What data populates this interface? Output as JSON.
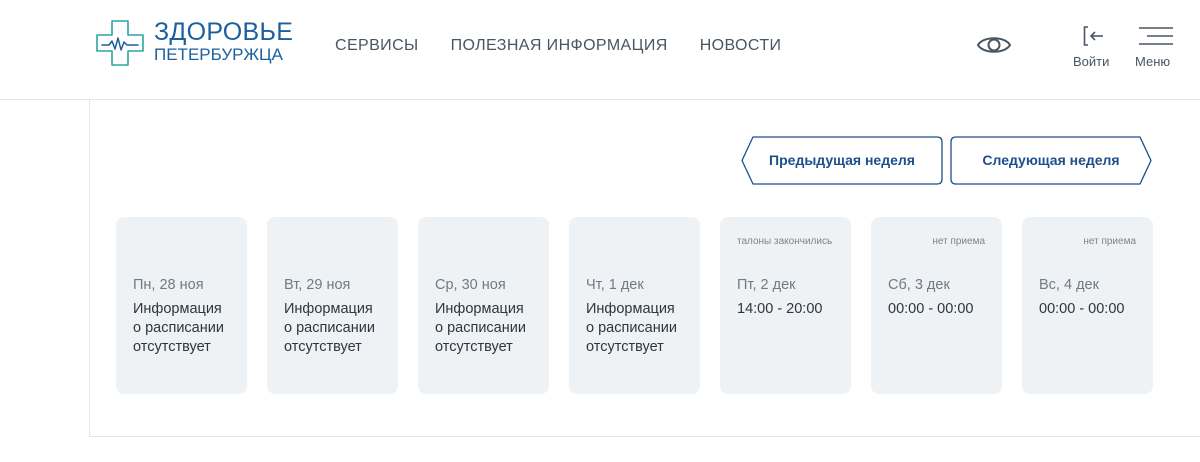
{
  "header": {
    "logo": {
      "title": "ЗДОРОВЬЕ",
      "subtitle": "ПЕТЕРБУРЖЦА",
      "accent": "#1b5f9e",
      "mark_color": "#2aa6a0"
    },
    "nav": [
      {
        "label": "СЕРВИСЫ"
      },
      {
        "label": "ПОЛЕЗНАЯ ИНФОРМАЦИЯ"
      },
      {
        "label": "НОВОСТИ"
      }
    ],
    "accessibility_icon": "eye-icon",
    "login": {
      "label": "Войти",
      "icon": "sign-in-icon"
    },
    "menu": {
      "label": "Меню",
      "icon": "hamburger-icon"
    }
  },
  "schedule": {
    "prev_week_label": "Предыдущая неделя",
    "next_week_label": "Следующая неделя",
    "button_color": "#1d4f8b",
    "card_color": "#eff2f4",
    "days": [
      {
        "note": "",
        "date": "Пн, 28 ноя",
        "info": "Информация о расписании отсутствует"
      },
      {
        "note": "",
        "date": "Вт, 29 ноя",
        "info": "Информация о расписании отсутствует"
      },
      {
        "note": "",
        "date": "Ср, 30 ноя",
        "info": "Информация о расписании отсутствует"
      },
      {
        "note": "",
        "date": "Чт, 1 дек",
        "info": "Информация о расписании отсутствует"
      },
      {
        "note": "талоны закончились",
        "date": "Пт, 2 дек",
        "info": "14:00 - 20:00"
      },
      {
        "note": "нет приема",
        "date": "Сб, 3 дек",
        "info": "00:00 - 00:00"
      },
      {
        "note": "нет приема",
        "date": "Вс, 4 дек",
        "info": "00:00 - 00:00"
      }
    ]
  }
}
